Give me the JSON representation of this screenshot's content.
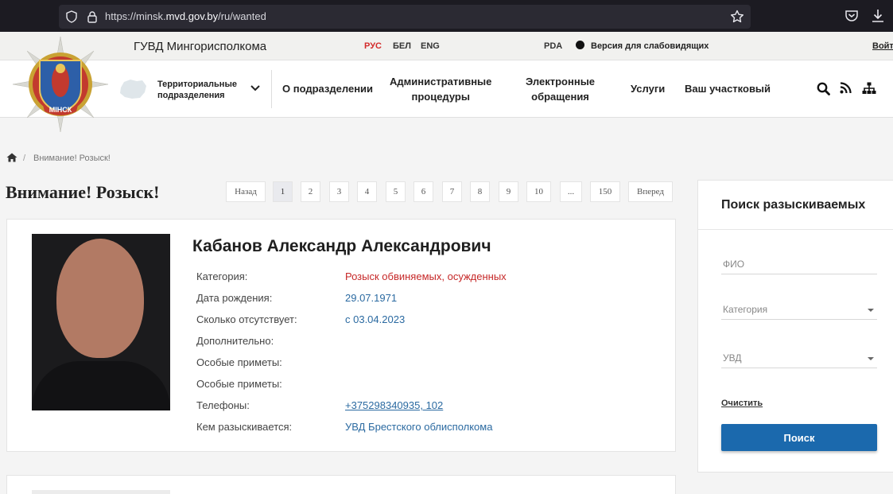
{
  "browser": {
    "url_prefix": "https://minsk.",
    "url_domain": "mvd.gov.by",
    "url_path": "/ru/wanted"
  },
  "header": {
    "org_name": "ГУВД Мингорисполкома",
    "languages": [
      "РУС",
      "БЕЛ",
      "ENG"
    ],
    "active_language": "РУС",
    "pda": "PDA",
    "low_vision": "Версия для слабовидящих",
    "login": "Войт",
    "logo_text": "МІНСК"
  },
  "nav": {
    "territorial_line1": "Территориальные",
    "territorial_line2": "подразделения",
    "items": [
      {
        "line1": "О подразделении",
        "line2": ""
      },
      {
        "line1": "Административные",
        "line2": "процедуры"
      },
      {
        "line1": "Электронные",
        "line2": "обращения"
      },
      {
        "line1": "Услуги",
        "line2": ""
      },
      {
        "line1": "Ваш участковый",
        "line2": ""
      }
    ]
  },
  "breadcrumb": {
    "separator": "/",
    "current": "Внимание! Розыск!"
  },
  "page_title": "Внимание! Розыск!",
  "pagination": {
    "prev": "Назад",
    "pages": [
      "1",
      "2",
      "3",
      "4",
      "5",
      "6",
      "7",
      "8",
      "9",
      "10",
      "...",
      "150"
    ],
    "active": "1",
    "next": "Вперед"
  },
  "person": {
    "name": "Кабанов Александр Александрович",
    "fields": [
      {
        "label": "Категория:",
        "value": "Розыск обвиняемых, осужденных"
      },
      {
        "label": "Дата рождения:",
        "value": "29.07.1971"
      },
      {
        "label": "Сколько отсутствует:",
        "value": "с 03.04.2023"
      },
      {
        "label": "Дополнительно:",
        "value": ""
      },
      {
        "label": "Особые приметы:",
        "value": ""
      },
      {
        "label": "Особые приметы:",
        "value": ""
      },
      {
        "label": "Телефоны:",
        "value": "+375298340935, 102"
      },
      {
        "label": "Кем разыскивается:",
        "value": "УВД Брестского облисполкома"
      }
    ]
  },
  "search_panel": {
    "title": "Поиск разыскиваемых",
    "fio_placeholder": "ФИО",
    "category_placeholder": "Категория",
    "uvd_placeholder": "УВД",
    "clear": "Очистить",
    "submit": "Поиск"
  },
  "colors": {
    "accent_blue": "#1b69ad",
    "active_red": "#d32b2b",
    "link_blue": "#2b6aa1"
  }
}
